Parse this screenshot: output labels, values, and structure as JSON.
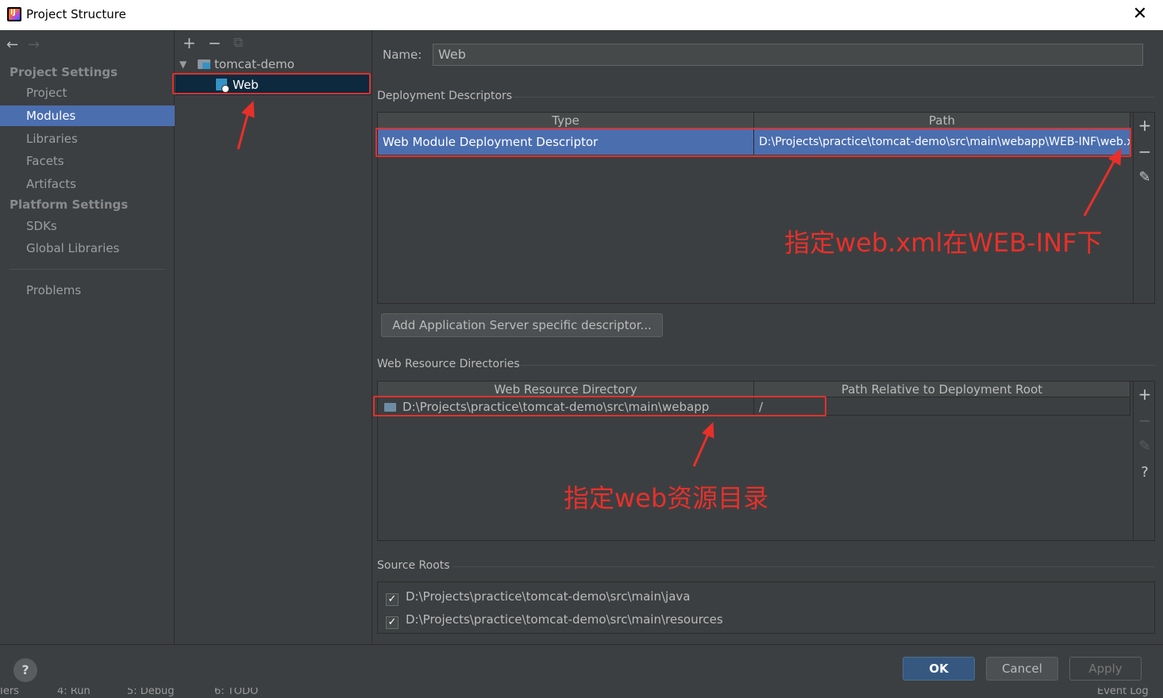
{
  "window": {
    "title": "Project Structure",
    "close_label": "✕"
  },
  "sidebar": {
    "back_icon": "←",
    "forward_icon": "→",
    "project_settings_heading": "Project Settings",
    "project_items": [
      {
        "label": "Project",
        "selected": false
      },
      {
        "label": "Modules",
        "selected": true
      },
      {
        "label": "Libraries",
        "selected": false
      },
      {
        "label": "Facets",
        "selected": false
      },
      {
        "label": "Artifacts",
        "selected": false
      }
    ],
    "platform_settings_heading": "Platform Settings",
    "platform_items": [
      {
        "label": "SDKs"
      },
      {
        "label": "Global Libraries"
      }
    ],
    "problems_label": "Problems"
  },
  "tree": {
    "toolbar": {
      "add": "+",
      "remove": "−",
      "copy": "⧉"
    },
    "expand_icon": "▼",
    "root_label": "tomcat-demo",
    "child_label": "Web"
  },
  "main": {
    "name_label": "Name:",
    "name_value": "Web",
    "deployment_descriptors": {
      "heading": "Deployment Descriptors",
      "columns": [
        "Type",
        "Path"
      ],
      "rows": [
        {
          "type": "Web Module Deployment Descriptor",
          "path": "D:\\Projects\\practice\\tomcat-demo\\src\\main\\webapp\\WEB-INF\\web.xml"
        }
      ],
      "tools": {
        "add": "+",
        "remove": "−",
        "edit": "✎"
      }
    },
    "add_server_descriptor_button": "Add Application Server specific descriptor...",
    "web_resource_directories": {
      "heading": "Web Resource Directories",
      "columns": [
        "Web Resource Directory",
        "Path Relative to Deployment Root"
      ],
      "rows": [
        {
          "directory": "D:\\Projects\\practice\\tomcat-demo\\src\\main\\webapp",
          "relative_path": "/"
        }
      ],
      "tools": {
        "add": "+",
        "remove": "−",
        "edit": "✎",
        "help": "?"
      }
    },
    "source_roots": {
      "heading": "Source Roots",
      "items": [
        {
          "path": "D:\\Projects\\practice\\tomcat-demo\\src\\main\\java",
          "checked": true
        },
        {
          "path": "D:\\Projects\\practice\\tomcat-demo\\src\\main\\resources",
          "checked": true
        }
      ]
    }
  },
  "footer": {
    "help": "?",
    "ok": "OK",
    "cancel": "Cancel",
    "apply": "Apply"
  },
  "statusbar": {
    "item1": "Iers",
    "item2": "4: Run",
    "item3": "5: Debug",
    "item4": "6: TODO",
    "item5": "Event Log"
  },
  "annotations": {
    "web_xml_note": "指定web.xml在WEB-INF下",
    "web_resource_note": "指定web资源目录",
    "accent_color": "#e8302a"
  }
}
